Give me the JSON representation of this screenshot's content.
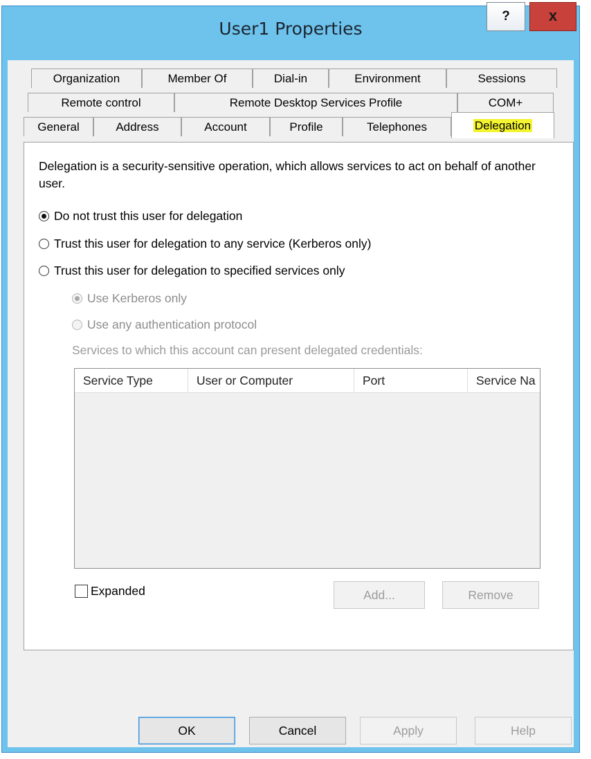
{
  "window": {
    "title": "User1 Properties"
  },
  "titlebar": {
    "help_label": "?",
    "close_label": "x"
  },
  "tabs": {
    "row1": [
      "Organization",
      "Member Of",
      "Dial-in",
      "Environment",
      "Sessions"
    ],
    "row2": [
      "Remote control",
      "Remote Desktop Services Profile",
      "COM+"
    ],
    "row3": [
      "General",
      "Address",
      "Account",
      "Profile",
      "Telephones",
      "Delegation"
    ],
    "selected": "Delegation"
  },
  "delegation": {
    "description": "Delegation is a security-sensitive operation, which allows services to act on behalf of another user.",
    "options": [
      {
        "label": "Do not trust this user for delegation",
        "checked": true
      },
      {
        "label": "Trust this user for delegation to any service (Kerberos only)",
        "checked": false
      },
      {
        "label": "Trust this user for delegation to specified services only",
        "checked": false
      }
    ],
    "sub_options": [
      {
        "label": "Use Kerberos only",
        "checked": true,
        "enabled": false
      },
      {
        "label": "Use any authentication protocol",
        "checked": false,
        "enabled": false
      }
    ],
    "list_label": "Services to which this account can present delegated credentials:",
    "columns": [
      "Service Type",
      "User or Computer",
      "Port",
      "Service Na"
    ],
    "expanded_label": "Expanded",
    "add_label": "Add...",
    "remove_label": "Remove"
  },
  "footer": {
    "ok": "OK",
    "cancel": "Cancel",
    "apply": "Apply",
    "help": "Help"
  },
  "colors": {
    "titlebar": "#6ec3ec",
    "close": "#c8413b",
    "highlight": "#f4f430"
  }
}
